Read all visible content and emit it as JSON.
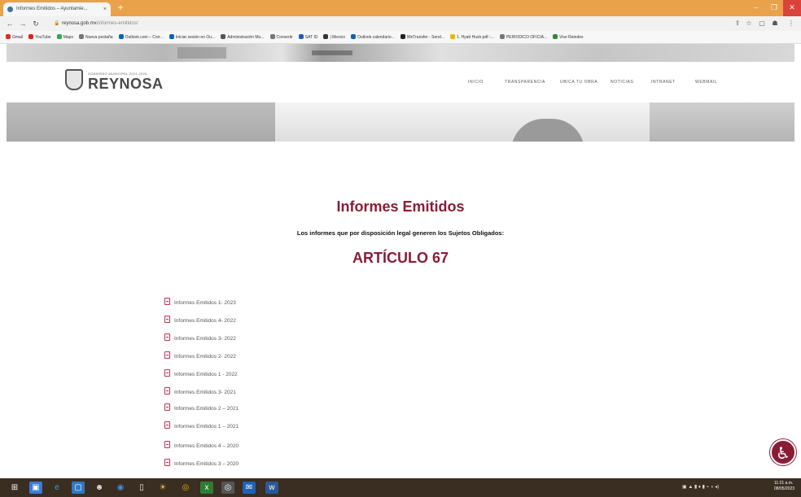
{
  "browser": {
    "tab_title": "Informes Emitidos – Ayuntamie...",
    "tab_close": "×",
    "new_tab": "+",
    "url_host": "reynosa.gob.mx",
    "url_path": "/informes-emitidos/",
    "back_icon": "arrow-left-icon",
    "forward_icon": "arrow-right-icon",
    "reload_icon": "reload-icon",
    "bookmarks": [
      {
        "label": "Gmail",
        "color": "#d93025"
      },
      {
        "label": "YouTube",
        "color": "#e62117"
      },
      {
        "label": "Maps",
        "color": "#34a853"
      },
      {
        "label": "Nueva pestaña",
        "color": "#777777"
      },
      {
        "label": "Outlook.com – Corr...",
        "color": "#0a64b6"
      },
      {
        "label": "Iniciar sesión en Ou...",
        "color": "#0a64b6"
      },
      {
        "label": "Administración Mu...",
        "color": "#555555"
      },
      {
        "label": "Convertir",
        "color": "#777777"
      },
      {
        "label": "SAT ID",
        "color": "#1f5fb4"
      },
      {
        "label": "| Mexico",
        "color": "#333333"
      },
      {
        "label": "Outlook calendario...",
        "color": "#0a64b6"
      },
      {
        "label": "WeTransfer - Send...",
        "color": "#222222"
      },
      {
        "label": "1. Hyatt Hush.pdf -...",
        "color": "#f2b400"
      },
      {
        "label": "PERIODICO OFICIA...",
        "color": "#777777"
      },
      {
        "label": "Vive Reindex",
        "color": "#2e8b3a"
      }
    ]
  },
  "site": {
    "logo_small": "GOBIERNO MUNICIPAL 2021-2024",
    "logo_text": "REYNOSA",
    "nav": [
      "INICIO",
      "TRANSPARENCIA",
      "UBICA TU OBRA",
      "NOTICIAS",
      "INTRANET",
      "WEBMAIL"
    ],
    "title": "Informes Emitidos",
    "subtitle": "Los informes que por disposición legal generen los Sujetos Obligados:",
    "article": "ARTÍCULO 67",
    "documents": [
      "Informes Emitidos 1- 2023",
      "Informes Emitidos 4- 2022",
      "Informes Emitidos 3- 2022",
      "Informes Emitidos 2- 2022",
      "Informes Emitidos 1 - 2022",
      "Informes Emitidos 3- 2021",
      "Informes Emitidos 2 – 2021",
      "Informes Emitidos 1 – 2021",
      "Informes Emitidos 4 – 2020",
      "Informes Emitidos 3 – 2020"
    ],
    "accessibility_icon": "accessibility-icon"
  },
  "taskbar": {
    "clock_time": "11:21 a.m.",
    "clock_date": "08/05/2023"
  },
  "colors": {
    "accent": "#8a1d36",
    "tabstrip": "#e9a14a",
    "taskbar": "#3a2d22"
  }
}
